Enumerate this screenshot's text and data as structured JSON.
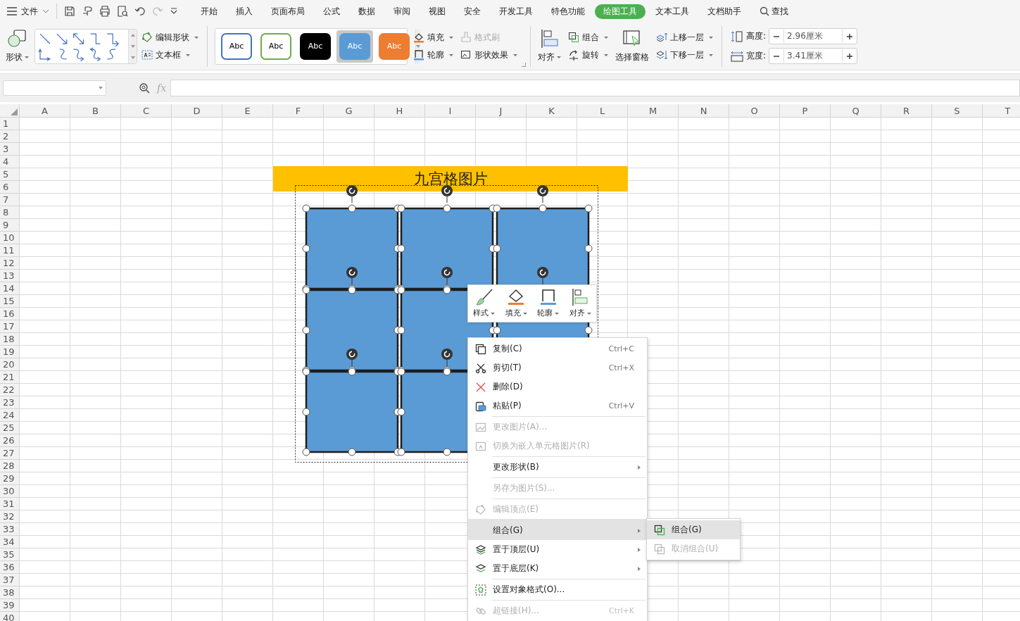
{
  "menu_bar": {
    "file": "文件",
    "search": "查找",
    "tabs": [
      {
        "label": "开始",
        "selected": false
      },
      {
        "label": "插入",
        "selected": false
      },
      {
        "label": "页面布局",
        "selected": false
      },
      {
        "label": "公式",
        "selected": false
      },
      {
        "label": "数据",
        "selected": false
      },
      {
        "label": "审阅",
        "selected": false
      },
      {
        "label": "视图",
        "selected": false
      },
      {
        "label": "安全",
        "selected": false
      },
      {
        "label": "开发工具",
        "selected": false
      },
      {
        "label": "特色功能",
        "selected": false
      },
      {
        "label": "绘图工具",
        "selected": true
      },
      {
        "label": "文本工具",
        "selected": false
      },
      {
        "label": "文档助手",
        "selected": false
      }
    ]
  },
  "ribbon": {
    "shape": "形状",
    "edit_shape": "编辑形状",
    "text_box": "文本框",
    "style_presets": [
      {
        "label": "Abc",
        "kind": "outline",
        "color": "#4472c4",
        "selected": false
      },
      {
        "label": "Abc",
        "kind": "outline",
        "color": "#70ad47",
        "selected": false
      },
      {
        "label": "Abc",
        "kind": "filled",
        "color": "#000000",
        "selected": false
      },
      {
        "label": "Abc",
        "kind": "filled",
        "color": "#5b9bd5",
        "selected": true
      },
      {
        "label": "Abc",
        "kind": "filled",
        "color": "#ed7d31",
        "selected": false
      }
    ],
    "fill": "填充",
    "format_painter": {
      "label": "格式刷",
      "disabled": true
    },
    "outline": "轮廓",
    "shape_effects": "形状效果",
    "align": "对齐",
    "group": "组合",
    "rotate": "旋转",
    "selection_pane": "选择窗格",
    "bring_forward": "上移一层",
    "send_backward": "下移一层",
    "height": {
      "label": "高度:",
      "value": "2.96厘米"
    },
    "width": {
      "label": "宽度:",
      "value": "3.41厘米"
    }
  },
  "formula_bar": {
    "fx": "fx"
  },
  "sheet": {
    "columns": [
      "A",
      "B",
      "C",
      "D",
      "E",
      "F",
      "G",
      "H",
      "I",
      "J",
      "K",
      "L",
      "M",
      "N",
      "O",
      "P",
      "Q",
      "R",
      "S",
      "T"
    ],
    "rows": [
      "1",
      "2",
      "3",
      "4",
      "5",
      "6",
      "7",
      "8",
      "9",
      "10",
      "11",
      "12",
      "13",
      "14",
      "15",
      "16",
      "17",
      "18",
      "19",
      "20",
      "21",
      "22",
      "23",
      "24",
      "25",
      "26",
      "27",
      "28",
      "29",
      "30",
      "31",
      "32",
      "33",
      "34",
      "35",
      "36",
      "37",
      "38",
      "39",
      "40"
    ],
    "title": "九宫格图片"
  },
  "mini_toolbar": [
    {
      "label": "样式"
    },
    {
      "label": "填充"
    },
    {
      "label": "轮廓"
    },
    {
      "label": "对齐"
    }
  ],
  "context_menu": [
    {
      "label": "复制(C)",
      "shortcut": "Ctrl+C",
      "disabled": false,
      "selected": false,
      "submenu": false,
      "separator_before": false
    },
    {
      "label": "剪切(T)",
      "shortcut": "Ctrl+X",
      "disabled": false,
      "selected": false,
      "submenu": false,
      "separator_before": false
    },
    {
      "label": "删除(D)",
      "disabled": false,
      "selected": false,
      "submenu": false,
      "separator_before": false
    },
    {
      "label": "粘贴(P)",
      "shortcut": "Ctrl+V",
      "disabled": false,
      "selected": false,
      "submenu": false,
      "separator_before": false
    },
    {
      "label": "更改图片(A)...",
      "disabled": true,
      "selected": false,
      "submenu": false,
      "separator_before": true
    },
    {
      "label": "切换为嵌入单元格图片(R)",
      "disabled": true,
      "selected": false,
      "submenu": false,
      "separator_before": false
    },
    {
      "label": "更改形状(B)",
      "disabled": false,
      "selected": false,
      "submenu": true,
      "separator_before": true
    },
    {
      "label": "另存为图片(S)...",
      "disabled": true,
      "selected": false,
      "submenu": false,
      "separator_before": true
    },
    {
      "label": "编辑顶点(E)",
      "disabled": true,
      "selected": false,
      "submenu": false,
      "separator_before": true
    },
    {
      "label": "组合(G)",
      "disabled": false,
      "selected": true,
      "submenu": true,
      "separator_before": true
    },
    {
      "label": "置于顶层(U)",
      "disabled": false,
      "selected": false,
      "submenu": true,
      "separator_before": false
    },
    {
      "label": "置于底层(K)",
      "disabled": false,
      "selected": false,
      "submenu": true,
      "separator_before": false
    },
    {
      "label": "设置对象格式(O)...",
      "disabled": false,
      "selected": false,
      "submenu": false,
      "separator_before": true
    },
    {
      "label": "超链接(H)...",
      "shortcut": "Ctrl+K",
      "disabled": true,
      "selected": false,
      "submenu": false,
      "separator_before": true
    }
  ],
  "submenu": [
    {
      "label": "组合(G)",
      "disabled": false,
      "selected": true
    },
    {
      "label": "取消组合(U)",
      "disabled": true,
      "selected": false
    }
  ]
}
